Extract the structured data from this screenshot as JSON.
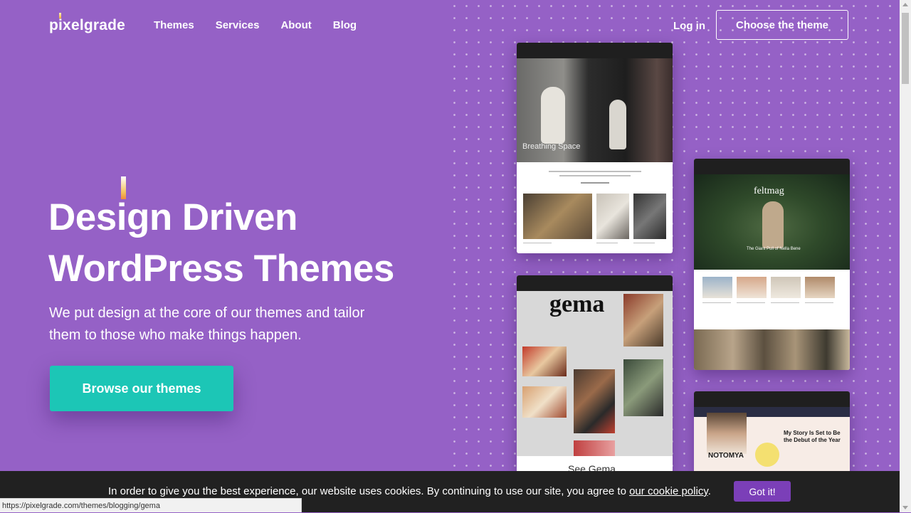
{
  "header": {
    "logo": "pixelgrade",
    "nav": [
      "Themes",
      "Services",
      "About",
      "Blog"
    ],
    "login": "Log in",
    "cta": "Choose the theme"
  },
  "hero": {
    "title_line1": "Design Driven",
    "title_line2": "WordPress Themes",
    "subtitle": "We put design at the core of our themes and tailor them to those who make things happen.",
    "button": "Browse our themes"
  },
  "previews": {
    "card1_title": "Breathing Space",
    "card2_title": "feltmag",
    "card2_caption": "The Giant Pull of Nella Bene",
    "card3_title": "gema",
    "card3_footer": "See Gema",
    "card4_name": "NOTOMYA",
    "card4_title": "My Story Is Set to Be the Debut of the Year"
  },
  "cookie": {
    "text": "In order to give you the best experience, our website uses cookies. By continuing to use our site, you agree to ",
    "link": "our cookie policy",
    "end": ".",
    "button": "Got it!"
  },
  "status_url": "https://pixelgrade.com/themes/blogging/gema",
  "colors": {
    "background": "#9561c6",
    "accent": "#1cc6b6",
    "cookie_button": "#7b3fb8"
  }
}
